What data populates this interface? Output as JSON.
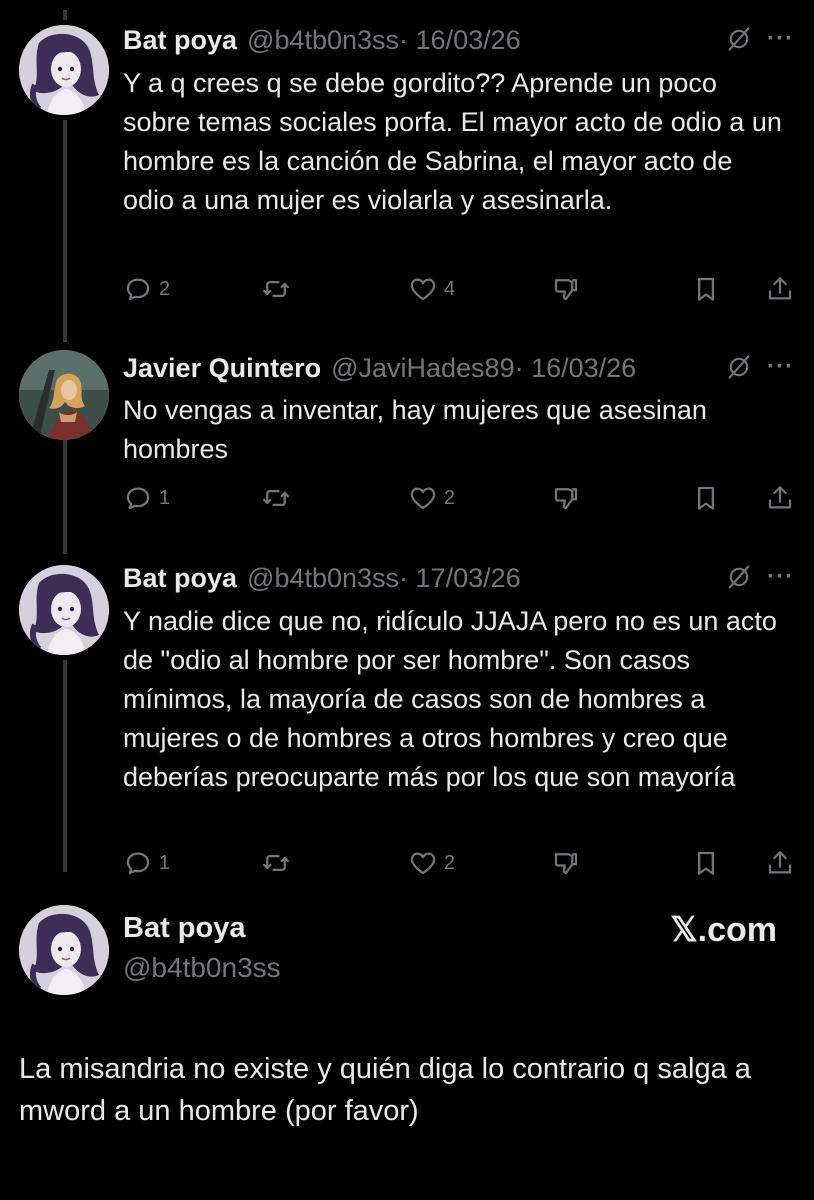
{
  "tweets": [
    {
      "name": "Bat poya",
      "handle": "@b4tb0n3ss",
      "date": "· 16/03/26",
      "text": "Y a q crees q se debe gordito?? Aprende un poco sobre temas sociales porfa. El mayor acto de odio a un hombre es la canción de Sabrina, el mayor acto de odio a una mujer es violarla y asesinarla.",
      "replies": "2",
      "likes": "4"
    },
    {
      "name": "Javier Quintero",
      "handle": "@JaviHades89",
      "date": "· 16/03/26",
      "text": "No vengas a inventar, hay mujeres que asesinan hombres",
      "replies": "1",
      "likes": "2"
    },
    {
      "name": "Bat poya",
      "handle": "@b4tb0n3ss",
      "date": "· 17/03/26",
      "text": "Y nadie dice que no, ridículo JJAJA pero no es un acto de \"odio al hombre por ser hombre\". Son casos mínimos, la mayoría de casos son de hombres a mujeres o de hombres a otros hombres y creo que deberías preocuparte más por los que son mayoría",
      "replies": "1",
      "likes": "2"
    }
  ],
  "main_tweet": {
    "name": "Bat poya",
    "handle": "@b4tb0n3ss",
    "brand": "𝕏.com",
    "text": "La misandria no existe y quién diga lo contrario q salga a mword a un hombre (por favor)"
  },
  "icons": {
    "reply": "reply-icon",
    "retweet": "retweet-icon",
    "like": "heart-icon",
    "dislike": "dislike-icon",
    "bookmark": "bookmark-icon",
    "share": "share-icon",
    "grok": "grok-icon",
    "more": "more-icon"
  },
  "colors": {
    "background": "#000000",
    "text": "#e7e9ea",
    "secondary": "#71767b",
    "thread_line": "#333639"
  }
}
